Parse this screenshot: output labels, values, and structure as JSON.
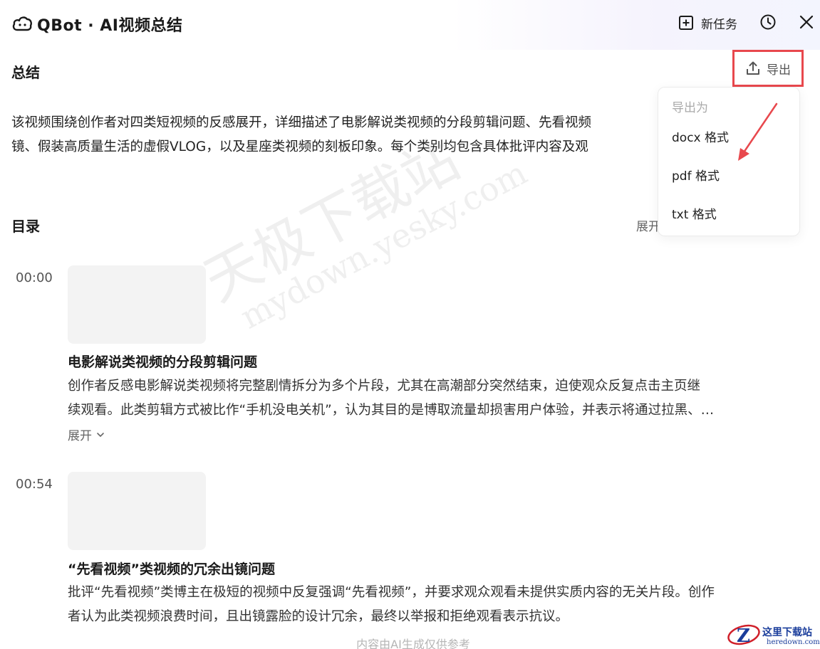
{
  "header": {
    "title": "QBot · AI视频总结",
    "new_task_label": "新任务"
  },
  "summary": {
    "heading": "总结",
    "lines": [
      "该视频围绕创作者对四类短视频的反感展开，详细描述了电影解说类视频的分段剪辑问题、先看视频",
      "镜、假装高质量生活的虚假VLOG，以及星座类视频的刻板印象。每个类别均包含具体批评内容及观"
    ]
  },
  "export": {
    "button_label": "导出",
    "menu_title": "导出为",
    "options": [
      "docx 格式",
      "pdf 格式",
      "txt 格式"
    ]
  },
  "toc": {
    "heading": "目录",
    "expand_all_label": "展开",
    "chapters": [
      {
        "time": "00:00",
        "title": "电影解说类视频的分段剪辑问题",
        "lines": [
          "创作者反感电影解说类视频将完整剧情拆分为多个片段，尤其在高潮部分突然结束，迫使观众反复点击主页继",
          "续观看。此类剪辑方式被比作“手机没电关机”，认为其目的是博取流量却损害用户体验，并表示将通过拉黑、…"
        ],
        "expand_label": "展开"
      },
      {
        "time": "00:54",
        "title": "“先看视频”类视频的冗余出镜问题",
        "lines": [
          "批评“先看视频”类博主在极短的视频中反复强调“先看视频”，并要求观众观看未提供实质内容的无关片段。创作",
          "者认为此类视频浪费时间，且出镜露脸的设计冗余，最终以举报和拒绝观看表示抗议。"
        ]
      }
    ]
  },
  "footer": {
    "note": "内容由AI生成仅供参考"
  },
  "watermark": {
    "line1": "天极下载站",
    "line2": "mydown.yesky.com"
  },
  "corner_logo": {
    "text": "这里下载站",
    "sub": "heredown.com"
  },
  "colors": {
    "highlight": "#e8484d",
    "muted": "#aaaaaa",
    "thumb": "#f3f3f3"
  }
}
